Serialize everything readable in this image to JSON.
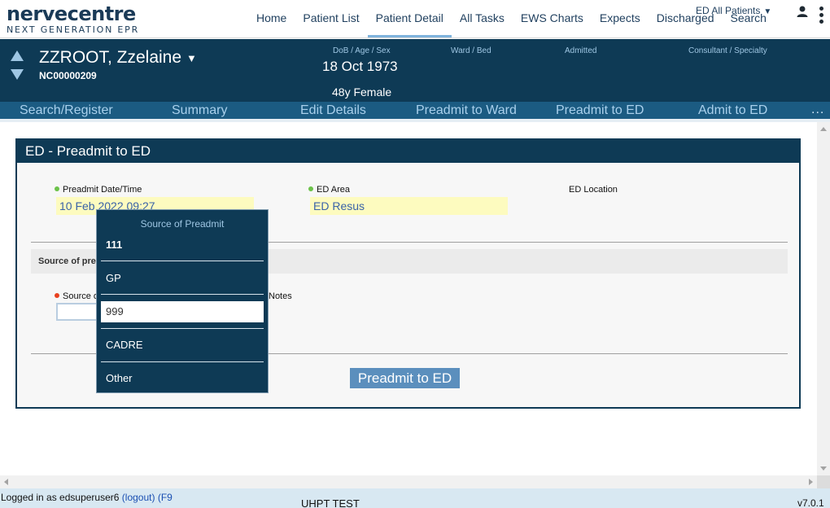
{
  "logo": {
    "main": "nervecentre",
    "sub": "NEXT GENERATION EPR"
  },
  "topnav": {
    "items": [
      {
        "label": "Home"
      },
      {
        "label": "Patient List"
      },
      {
        "label": "Patient Detail"
      },
      {
        "label": "All Tasks"
      },
      {
        "label": "EWS Charts"
      },
      {
        "label": "Expects"
      },
      {
        "label": "Discharged"
      },
      {
        "label": "Search"
      }
    ],
    "active": "Patient Detail",
    "ed_filter": "ED All Patients"
  },
  "patient": {
    "name": "ZZROOT, Zzelaine",
    "id": "NC00000209",
    "labels": {
      "dob_age_sex": "DoB / Age / Sex",
      "ward_bed": "Ward / Bed",
      "admitted": "Admitted",
      "consultant": "Consultant / Specialty"
    },
    "dob": "18 Oct 1973",
    "age_sex": "48y Female"
  },
  "actions": [
    {
      "label": "Search/Register"
    },
    {
      "label": "Summary"
    },
    {
      "label": "Edit Details"
    },
    {
      "label": "Preadmit to Ward"
    },
    {
      "label": "Preadmit to ED"
    },
    {
      "label": "Admit to ED"
    }
  ],
  "more_label": "...",
  "panel": {
    "title": "ED - Preadmit to ED",
    "preadmit_label": "Preadmit Date/Time",
    "preadmit_value": "10 Feb 2022 09:27",
    "ed_area_label": "ED Area",
    "ed_area_value": "ED Resus",
    "ed_location_label": "ED Location",
    "section_title": "Source of pre",
    "source_label": "Source o",
    "notes_label": "Notes",
    "submit_label": "Preadmit to ED"
  },
  "popup": {
    "title": "Source of Preadmit",
    "options": [
      "111",
      "GP",
      "999",
      "CADRE",
      "Other"
    ],
    "selected": "999"
  },
  "footer": {
    "login_text": "Logged in as edsuperuser6",
    "logout_label": "(logout)",
    "f9_label": "(F9",
    "env": "UHPT TEST",
    "version": "v7.0.1"
  }
}
